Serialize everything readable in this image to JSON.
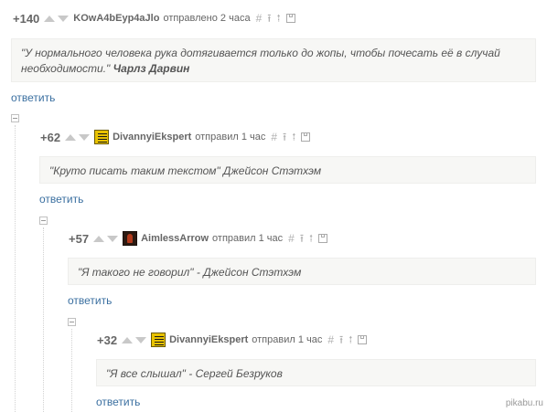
{
  "comments": [
    {
      "rating": "+140",
      "author": "KOwA4bEyp4aJlo",
      "time": "отправлено 2 часа",
      "avatar": "none",
      "text_main": "\"У нормального человека рука дотягивается только до жопы, чтобы почесать её в случай необходимости.\"",
      "text_bold": "Чарлз Дарвин",
      "reply": "ответить"
    },
    {
      "rating": "+62",
      "author": "DivannyiEkspert",
      "time": "отправил 1 час",
      "avatar": "book-avatar",
      "text_main": "\"Круто писать таким текстом\"  Джейсон Стэтхэм",
      "reply": "ответить"
    },
    {
      "rating": "+57",
      "author": "AimlessArrow",
      "time": "отправил 1 час",
      "avatar": "arrow-avatar",
      "text_main": "\"Я такого не говорил\" - Джейсон Стэтхэм",
      "reply": "ответить"
    },
    {
      "rating": "+32",
      "author": "DivannyiEkspert",
      "time": "отправил 1 час",
      "avatar": "book-avatar",
      "text_main": "\"Я все слышал\"  - Сергей Безруков",
      "reply": "ответить"
    }
  ],
  "icons": {
    "link": "#",
    "up_arrow": "⭱",
    "branch": "⭫",
    "save": "save-icon"
  },
  "watermark": "pikabu.ru",
  "colors": {
    "link": "#3a6fa0",
    "quote_bg": "#f7f7f5"
  }
}
